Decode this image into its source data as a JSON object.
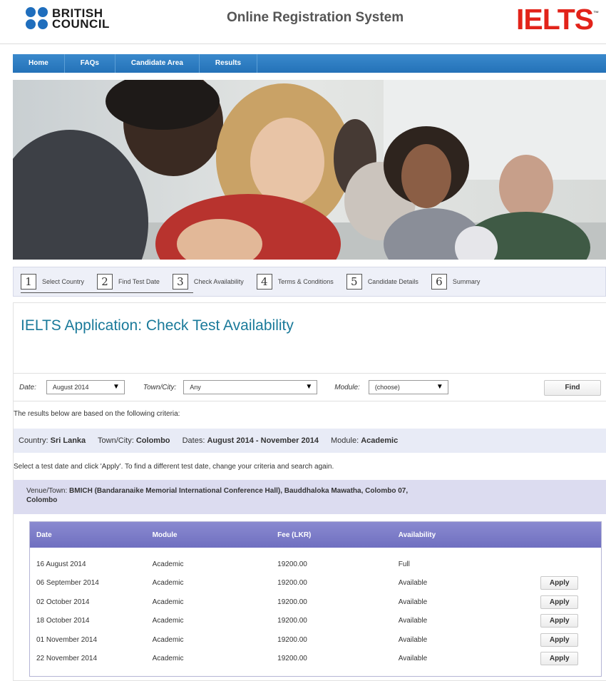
{
  "header": {
    "brand_line1": "BRITISH",
    "brand_line2": "COUNCIL",
    "site_title": "Online Registration System",
    "ielts_logo": "IELTS",
    "ielts_tm": "™"
  },
  "nav": {
    "items": [
      {
        "label": "Home"
      },
      {
        "label": "FAQs"
      },
      {
        "label": "Candidate Area"
      },
      {
        "label": "Results"
      }
    ]
  },
  "steps": [
    {
      "num": "1",
      "label": "Select Country"
    },
    {
      "num": "2",
      "label": "Find Test Date"
    },
    {
      "num": "3",
      "label": "Check Availability"
    },
    {
      "num": "4",
      "label": "Terms & Conditions"
    },
    {
      "num": "5",
      "label": "Candidate Details"
    },
    {
      "num": "6",
      "label": "Summary"
    }
  ],
  "page_title": "IELTS Application: Check Test Availability",
  "filters": {
    "date_label": "Date:",
    "date_value": "August 2014",
    "town_label": "Town/City:",
    "town_value": "Any",
    "module_label": "Module:",
    "module_value": "(choose)",
    "find_label": "Find"
  },
  "criteria_intro": "The results below are based on the following criteria:",
  "criteria": {
    "country_label": "Country:",
    "country_value": "Sri Lanka",
    "town_label": "Town/City:",
    "town_value": "Colombo",
    "dates_label": "Dates:",
    "dates_value": "August 2014 - November 2014",
    "module_label": "Module:",
    "module_value": "Academic"
  },
  "select_note": "Select a test date and click 'Apply'. To find a different test date, change your criteria and search again.",
  "venue": {
    "label": "Venue/Town:",
    "value": "BMICH (Bandaranaike Memorial International Conference Hall), Bauddhaloka Mawatha, Colombo 07,",
    "value_line2": "Colombo"
  },
  "table": {
    "headers": [
      "Date",
      "Module",
      "Fee (LKR)",
      "Availability"
    ],
    "apply_label": "Apply",
    "rows": [
      {
        "date": "16 August 2014",
        "module": "Academic",
        "fee": "19200.00",
        "availability": "Full"
      },
      {
        "date": "06 September 2014",
        "module": "Academic",
        "fee": "19200.00",
        "availability": "Available"
      },
      {
        "date": "02 October 2014",
        "module": "Academic",
        "fee": "19200.00",
        "availability": "Available"
      },
      {
        "date": "18 October 2014",
        "module": "Academic",
        "fee": "19200.00",
        "availability": "Available"
      },
      {
        "date": "01 November 2014",
        "module": "Academic",
        "fee": "19200.00",
        "availability": "Available"
      },
      {
        "date": "22 November 2014",
        "module": "Academic",
        "fee": "19200.00",
        "availability": "Available"
      }
    ]
  },
  "colors": {
    "brand_blue": "#1f6ebd",
    "ielts_red": "#e2231a",
    "nav_blue": "#2472b8",
    "title_teal": "#1a7a9a",
    "table_header": "#7a7ac6"
  }
}
